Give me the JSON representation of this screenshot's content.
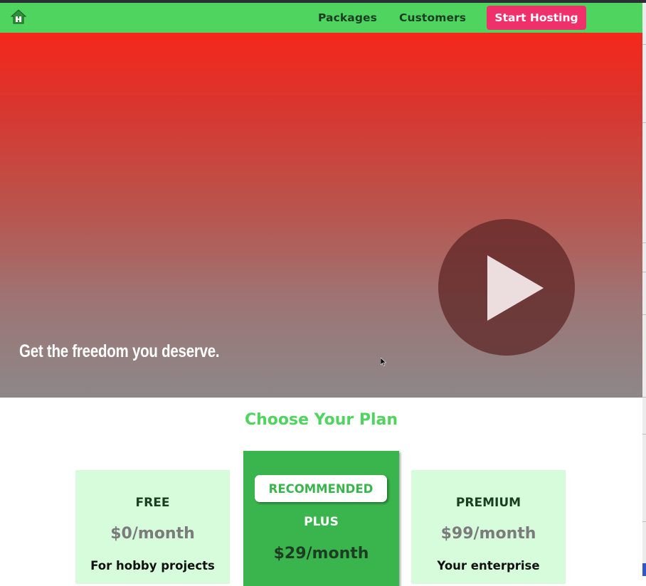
{
  "header": {
    "logo_icon": "house-icon",
    "nav": {
      "packages_label": "Packages",
      "customers_label": "Customers"
    },
    "cta_label": "Start Hosting",
    "colors": {
      "navbar": "#4fd460",
      "cta": "#f0306a"
    }
  },
  "hero": {
    "tagline": "Get the freedom you deserve.",
    "play_icon": "play-icon",
    "gradient": [
      "#f5271b",
      "#8d8788"
    ]
  },
  "plans": {
    "section_title": "Choose Your Plan",
    "free": {
      "name": "FREE",
      "price": "$0/month",
      "description": "For hobby projects"
    },
    "plus": {
      "badge": "RECOMMENDED",
      "name": "PLUS",
      "price": "$29/month"
    },
    "premium": {
      "name": "PREMIUM",
      "price": "$99/month",
      "description": "Your enterprise"
    }
  }
}
